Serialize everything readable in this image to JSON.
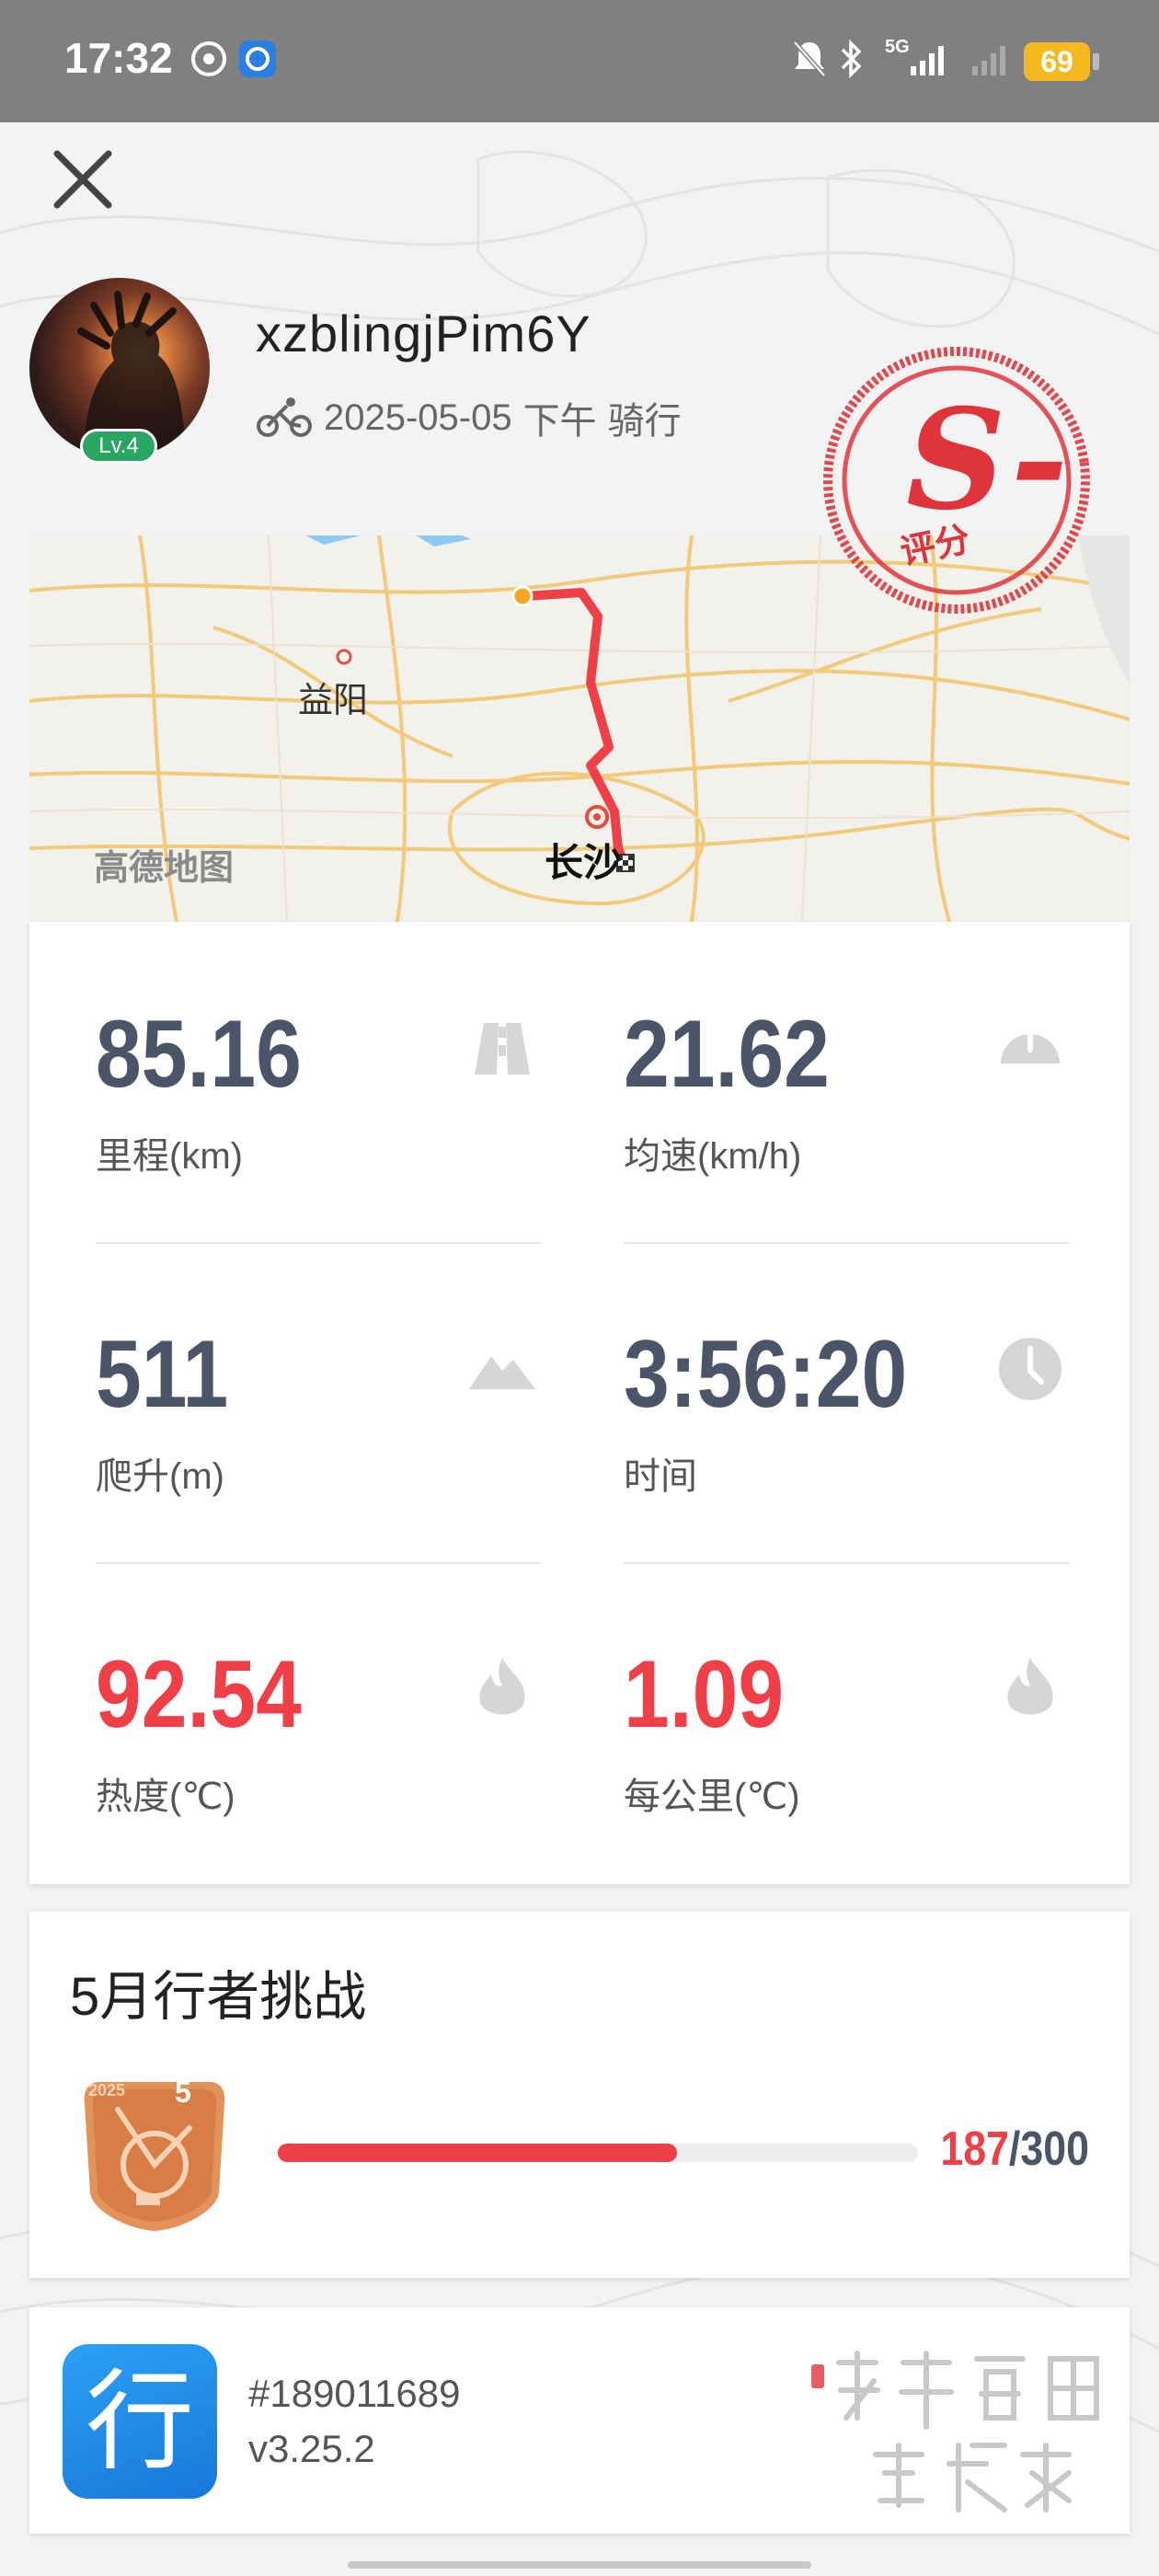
{
  "status_bar": {
    "time": "17:32",
    "network": "5G",
    "battery": "69"
  },
  "header": {
    "username": "xzblingjPim6Y",
    "level": "Lv.4",
    "date": "2025-05-05",
    "period": "下午",
    "activity": "骑行",
    "grade": "S-",
    "grade_label": "评分"
  },
  "map": {
    "city_left": "益阳",
    "city_main": "长沙",
    "provider": "高德地图"
  },
  "stats": [
    {
      "value": "85.16",
      "label": "里程(km)",
      "icon": "road-icon",
      "color": "gray"
    },
    {
      "value": "21.62",
      "label": "均速(km/h)",
      "icon": "speedometer-icon",
      "color": "gray"
    },
    {
      "value": "511",
      "label": "爬升(m)",
      "icon": "mountain-icon",
      "color": "gray"
    },
    {
      "value": "3:56:20",
      "label": "时间",
      "icon": "clock-icon",
      "color": "gray"
    },
    {
      "value": "92.54",
      "label": "热度(℃)",
      "icon": "flame-icon",
      "color": "red"
    },
    {
      "value": "1.09",
      "label": "每公里(℃)",
      "icon": "flame-icon",
      "color": "red"
    }
  ],
  "challenge": {
    "title": "5月行者挑战",
    "medal_year": "2025",
    "medal_month": "5",
    "current": "187",
    "separator": "/",
    "total": "300",
    "progress_fraction": 0.623
  },
  "app": {
    "icon_glyph": "行",
    "id": "#189011689",
    "version": "v3.25.2"
  },
  "colors": {
    "accent_red": "#ef4048",
    "value_gray": "#4b5568",
    "level_green": "#2aa562",
    "app_blue": "#1877d9"
  }
}
